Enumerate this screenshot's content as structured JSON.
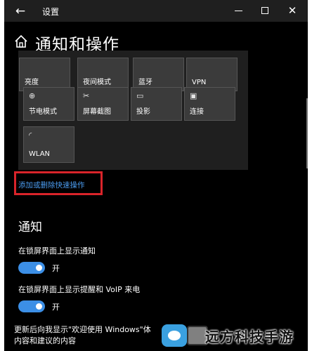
{
  "window": {
    "title": "设置"
  },
  "header": {
    "title": "通知和操作"
  },
  "quick_actions": {
    "tiles": [
      {
        "label": "亮度",
        "icon": "brightness-icon",
        "glyph": ""
      },
      {
        "label": "夜间模式",
        "icon": "night-mode-icon",
        "glyph": ""
      },
      {
        "label": "蓝牙",
        "icon": "bluetooth-icon",
        "glyph": ""
      },
      {
        "label": "VPN",
        "icon": "vpn-icon",
        "glyph": ""
      },
      {
        "label": "节电模式",
        "icon": "battery-saver-icon",
        "glyph": "⊕"
      },
      {
        "label": "屏幕截图",
        "icon": "screenshot-icon",
        "glyph": "✂"
      },
      {
        "label": "投影",
        "icon": "project-icon",
        "glyph": "▭"
      },
      {
        "label": "连接",
        "icon": "connect-icon",
        "glyph": "▣"
      },
      {
        "label": "WLAN",
        "icon": "wifi-icon",
        "glyph": "◜"
      }
    ],
    "add_remove_link": "添加或删除快速操作"
  },
  "notifications": {
    "heading": "通知",
    "lock_screen_notifications": {
      "label": "在锁屏界面上显示通知",
      "state": "开"
    },
    "lock_screen_reminders": {
      "label": "在锁屏界面上显示提醒和 VoIP 来电",
      "state": "开"
    },
    "welcome_line1": "更新后向我显示\"欢迎使用 Windows\"体",
    "welcome_line2": "内容和建议的内容"
  },
  "watermark": {
    "text": "远方科技手游"
  },
  "colors": {
    "accent": "#3c8fe6",
    "link": "#4b9cf0",
    "highlight_box": "#d9242a",
    "tile": "#3b3b3b"
  }
}
